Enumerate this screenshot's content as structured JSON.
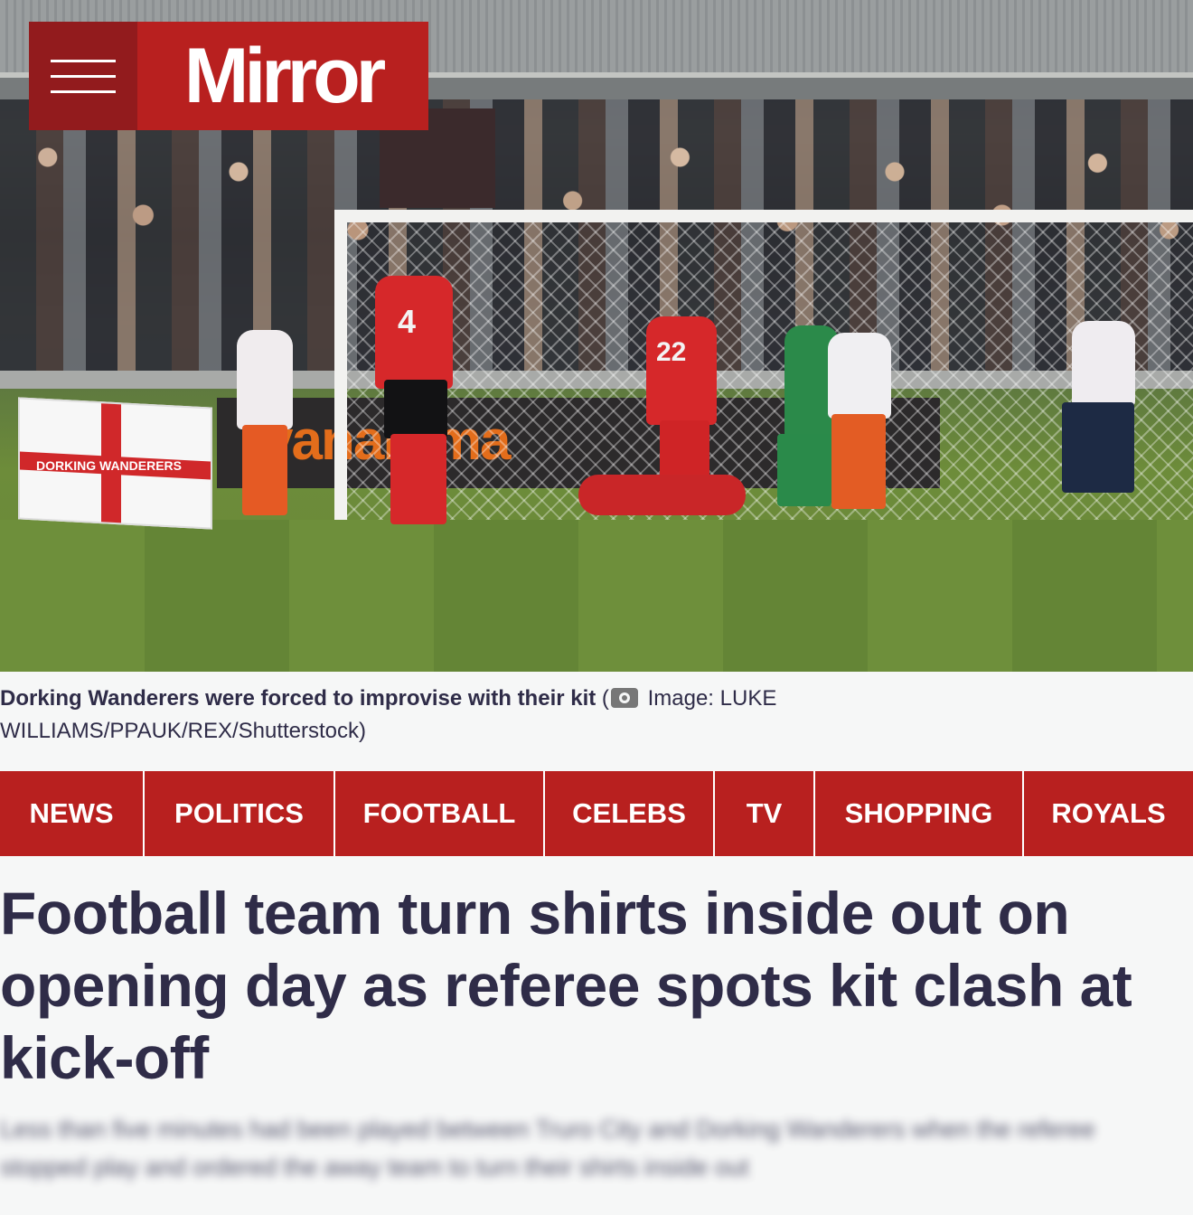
{
  "header": {
    "logo_text": "Mirror",
    "menu_icon": "hamburger-icon",
    "brand_color": "#b8201f",
    "menu_bg_color": "#921b1d"
  },
  "hero": {
    "adboard_text": "vanarama",
    "flag_text": "DORKING WANDERERS",
    "shirt_numbers": [
      "4",
      "22"
    ]
  },
  "caption": {
    "text": "Dorking Wanderers were forced to improvise with their kit",
    "open_paren": "(",
    "credit": "Image: LUKE WILLIAMS/PPAUK/REX/Shutterstock)",
    "icon": "camera-icon"
  },
  "nav": {
    "items": [
      {
        "label": "NEWS"
      },
      {
        "label": "POLITICS"
      },
      {
        "label": "FOOTBALL"
      },
      {
        "label": "CELEBS"
      },
      {
        "label": "TV"
      },
      {
        "label": "SHOPPING"
      },
      {
        "label": "ROYALS"
      }
    ]
  },
  "article": {
    "headline": "Football team turn shirts inside out on opening day as referee spots kit clash at kick-off",
    "standfirst": "Less than five minutes had been played between Truro City and Dorking Wanderers when the referee stopped play and ordered the away team to turn their shirts inside out"
  }
}
